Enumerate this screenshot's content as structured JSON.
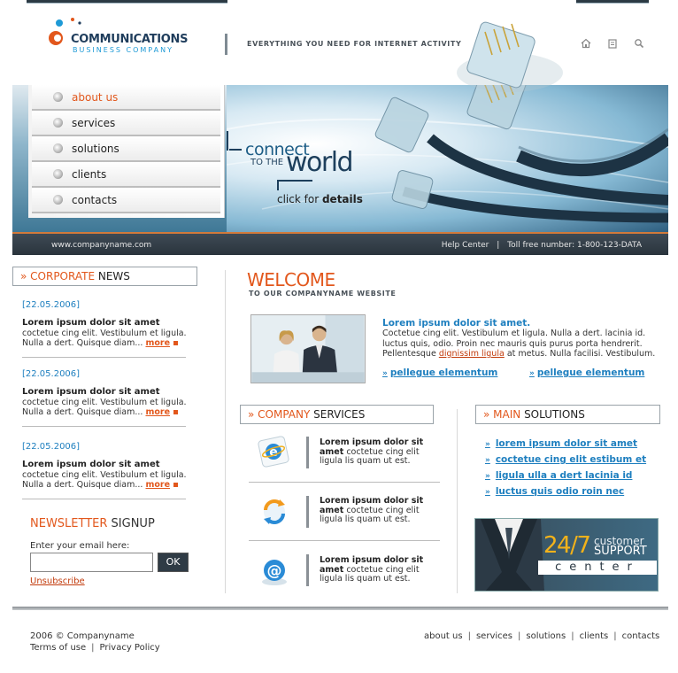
{
  "header": {
    "logo_title": "COMMUNICATIONS",
    "logo_subtitle": "BUSINESS COMPANY",
    "tagline": "EVERYTHING YOU NEED FOR INTERNET ACTIVITY",
    "icons": [
      "home-icon",
      "bookmark-icon",
      "search-icon"
    ]
  },
  "nav": {
    "items": [
      {
        "label": "about us",
        "active": true
      },
      {
        "label": "services",
        "active": false
      },
      {
        "label": "solutions",
        "active": false
      },
      {
        "label": "clients",
        "active": false
      },
      {
        "label": "contacts",
        "active": false
      }
    ]
  },
  "banner": {
    "connect": "connect",
    "to_the": "TO THE",
    "world": "world",
    "click_prefix": "click for",
    "click_bold": "details"
  },
  "infobar": {
    "website": "www.companyname.com",
    "help": "Help Center",
    "separator": "|",
    "toll_free": "Toll free number: 1-800-123-DATA"
  },
  "news": {
    "title_accent": "CORPORATE",
    "title_rest": "NEWS",
    "items": [
      {
        "date": "[22.05.2006]",
        "title": "Lorem ipsum dolor sit amet",
        "body": "coctetue cing elit. Vestibulum et ligula. Nulla a dert. Quisque diam...",
        "more": "more"
      },
      {
        "date": "[22.05.2006]",
        "title": "Lorem ipsum dolor sit amet",
        "body": "coctetue cing elit. Vestibulum et ligula. Nulla a dert. Quisque diam...",
        "more": "more"
      },
      {
        "date": "[22.05.2006]",
        "title": "Lorem ipsum dolor sit amet",
        "body": "coctetue cing elit. Vestibulum et ligula. Nulla a dert. Quisque diam...",
        "more": "more"
      }
    ]
  },
  "newsletter": {
    "title_accent": "NEWSLETTER",
    "title_rest": "SIGNUP",
    "label": "Enter your email here:",
    "input_value": "",
    "button": "OK",
    "unsubscribe": "Unsubscribe"
  },
  "welcome": {
    "title": "WELCOME",
    "subtitle": "TO OUR COMPANYNAME WEBSITE",
    "heading": "Lorem ipsum dolor sit amet.",
    "body_before": "Coctetue cing elit. Vestibulum et ligula. Nulla a dert. lacinia id. luctus quis, odio. Proin nec mauris quis purus porta hendrerit. Pellentesque",
    "body_link": "dignissim ligula",
    "body_after": "at metus. Nulla facilisi. Vestibulum.",
    "links": [
      "pellegue elementum",
      "pellegue elementum"
    ]
  },
  "services": {
    "title_accent": "COMPANY",
    "title_rest": "SERVICES",
    "items": [
      {
        "icon": "internet-explorer-icon",
        "title": "Lorem ipsum dolor sit amet",
        "body": "coctetue cing elit ligula lis quam ut est."
      },
      {
        "icon": "refresh-icon",
        "title": "Lorem ipsum dolor sit amet",
        "body": "coctetue cing elit ligula lis quam ut est."
      },
      {
        "icon": "email-at-icon",
        "title": "Lorem ipsum dolor sit amet",
        "body": "coctetue cing elit ligula lis quam ut est."
      }
    ]
  },
  "solutions": {
    "title_accent": "MAIN",
    "title_rest": "SOLUTIONS",
    "items": [
      "lorem ipsum dolor sit amet",
      "coctetue cing elit estibum et",
      "ligula ulla a dert lacinia id",
      "luctus quis odio roin nec"
    ]
  },
  "support": {
    "hours": "24/7",
    "customer": "customer",
    "support": "SUPPORT",
    "center": "center"
  },
  "footer": {
    "copyright": "2006 © Companyname",
    "terms": "Terms of use",
    "privacy": "Privacy Policy",
    "sep": "|",
    "links": [
      "about us",
      "services",
      "solutions",
      "clients",
      "contacts"
    ]
  },
  "colors": {
    "accent_orange": "#e2571c",
    "link_blue": "#1e7fbf",
    "dark_bar": "#2f3b45"
  }
}
